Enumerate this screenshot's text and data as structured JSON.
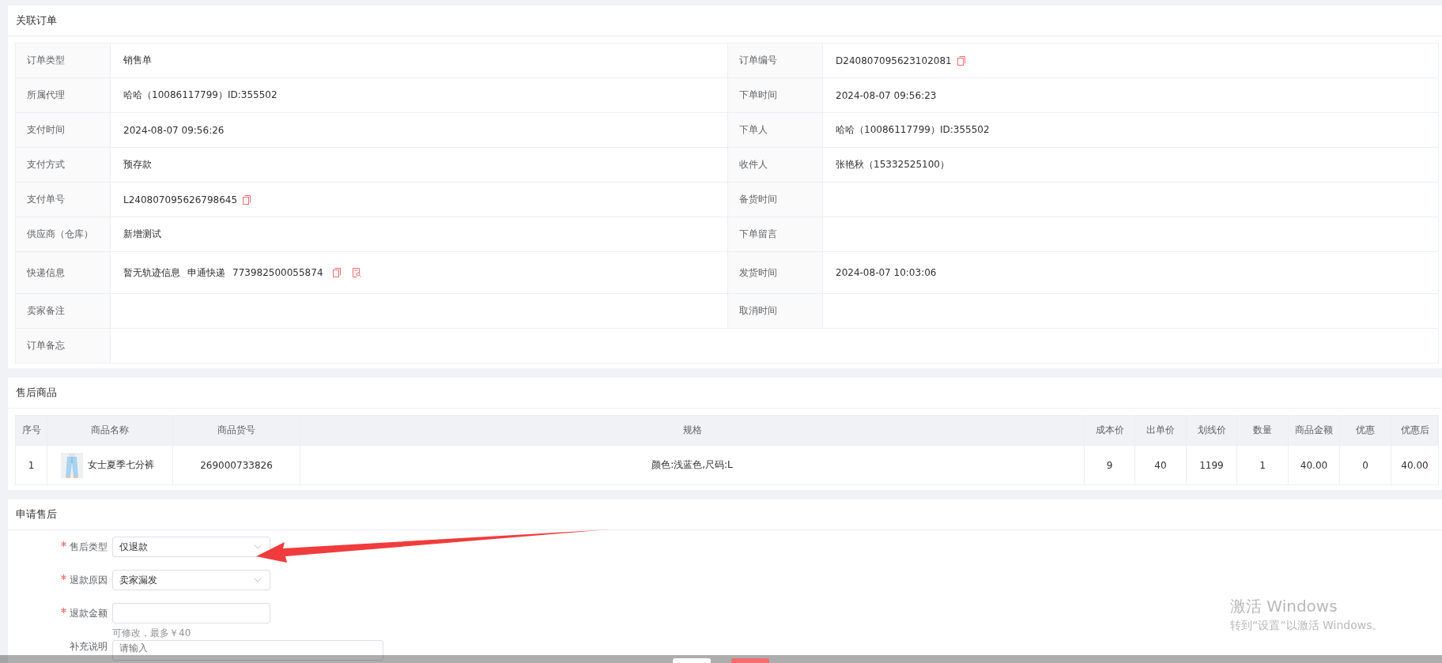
{
  "order": {
    "title": "关联订单",
    "rows": [
      {
        "cells": [
          {
            "label": "订单类型",
            "value": "销售单"
          },
          {
            "label": "订单编号",
            "value": "D240807095623102081",
            "copyable": true
          }
        ]
      },
      {
        "cells": [
          {
            "label": "所属代理",
            "value": "哈哈（10086117799）ID:355502"
          },
          {
            "label": "下单时间",
            "value": "2024-08-07 09:56:23"
          }
        ]
      },
      {
        "cells": [
          {
            "label": "支付时间",
            "value": "2024-08-07 09:56:26"
          },
          {
            "label": "下单人",
            "value": "哈哈（10086117799）ID:355502"
          }
        ]
      },
      {
        "cells": [
          {
            "label": "支付方式",
            "value": "预存款"
          },
          {
            "label": "收件人",
            "value": "张艳秋（15332525100）"
          }
        ]
      },
      {
        "cells": [
          {
            "label": "支付单号",
            "value": "L240807095626798645",
            "copyable": true
          },
          {
            "label": "备货时间"
          }
        ]
      },
      {
        "cells": [
          {
            "label": "供应商（仓库）",
            "value": "新增测试"
          },
          {
            "label": "下单留言"
          }
        ]
      },
      {
        "cells": [
          {
            "label": "快递信息",
            "parts": [
              "暂无轨迹信息",
              "申通快递",
              "773982500055874"
            ],
            "copyable": true,
            "trackable": true
          },
          {
            "label": "发货时间",
            "value": "2024-08-07 10:03:06"
          }
        ]
      },
      {
        "cells": [
          {
            "label": "卖家备注"
          },
          {
            "label": "取消时间"
          }
        ]
      },
      {
        "cells": [
          {
            "label": "订单备忘"
          }
        ]
      }
    ]
  },
  "goods": {
    "title": "售后商品",
    "columns": [
      {
        "label": "序号"
      },
      {
        "label": "商品名称",
        "kind": "product"
      },
      {
        "label": "商品货号"
      },
      {
        "label": "规格"
      },
      {
        "label": "成本价"
      },
      {
        "label": "出单价"
      },
      {
        "label": "划线价"
      },
      {
        "label": "数量"
      },
      {
        "label": "商品金额"
      },
      {
        "label": "优惠"
      },
      {
        "label": "优惠后"
      }
    ],
    "rows": [
      {
        "cells": [
          "1",
          "女士夏季七分裤",
          "269000733826",
          "颜色:浅蓝色,尺码:L",
          "9",
          "40",
          "1199",
          "1",
          "40.00",
          "0",
          "40.00"
        ]
      }
    ]
  },
  "apply": {
    "title": "申请售后",
    "fields": [
      {
        "kind": "select",
        "label": "售后类型",
        "required": true,
        "value": "仅退款"
      },
      {
        "kind": "select",
        "label": "退款原因",
        "required": true,
        "value": "卖家漏发"
      },
      {
        "kind": "input",
        "label": "退款金额",
        "required": true,
        "hint": "可修改，最多￥40"
      },
      {
        "kind": "textarea",
        "label": "补充说明",
        "required": false,
        "placeholder": "请输入"
      }
    ]
  },
  "footer": {
    "buttons": [
      {
        "kind": "default"
      },
      {
        "kind": "primary"
      }
    ]
  },
  "os_notice": {
    "title": "激活 Windows",
    "text": "转到“设置”以激活 Windows。"
  }
}
